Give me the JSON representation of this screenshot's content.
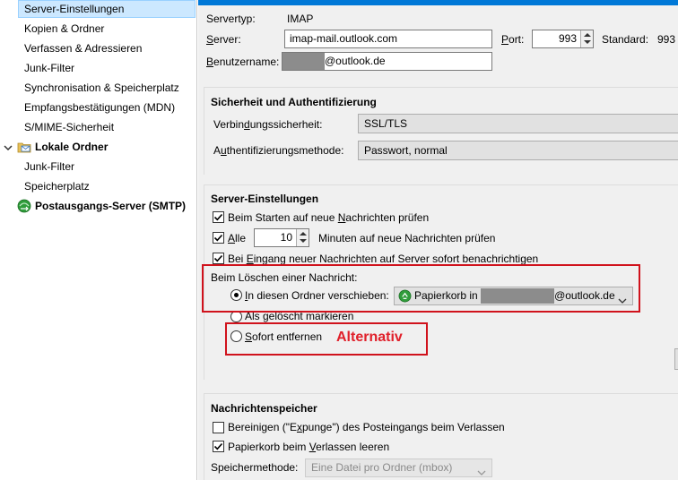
{
  "sidebar": {
    "items": [
      {
        "label": "Server-Einstellungen"
      },
      {
        "label": "Kopien & Ordner"
      },
      {
        "label": "Verfassen & Adressieren"
      },
      {
        "label": "Junk-Filter"
      },
      {
        "label": "Synchronisation & Speicherplatz"
      },
      {
        "label": "Empfangsbestätigungen (MDN)"
      },
      {
        "label": "S/MIME-Sicherheit"
      },
      {
        "label": "Lokale Ordner"
      },
      {
        "label": "Junk-Filter"
      },
      {
        "label": "Speicherplatz"
      },
      {
        "label": "Postausgangs-Server (SMTP)"
      }
    ]
  },
  "server": {
    "type_label": "Servertyp:",
    "type_value": "IMAP",
    "server_label_pre": "",
    "server_label_u": "S",
    "server_label_post": "erver:",
    "server_value": "imap-mail.outlook.com",
    "port_label_u": "P",
    "port_label_post": "ort:",
    "port_value": "993",
    "standard_label": "Standard:",
    "standard_value": "993",
    "user_label_u": "B",
    "user_label_post": "enutzername:",
    "user_suffix": "@outlook.de"
  },
  "security": {
    "title": "Sicherheit und Authentifizierung",
    "conn_label_pre": "Verbin",
    "conn_label_u": "d",
    "conn_label_post": "ungssicherheit:",
    "conn_value": "SSL/TLS",
    "auth_label_pre": "A",
    "auth_label_u": "u",
    "auth_label_post": "thentifizierungsmethode:",
    "auth_value": "Passwort, normal"
  },
  "server_settings": {
    "title": "Server-Einstellungen",
    "check_start_pre": "Beim Starten auf neue ",
    "check_start_u": "N",
    "check_start_post": "achrichten prüfen",
    "check_every_u": "A",
    "check_every_post": "lle",
    "every_value": "10",
    "every_suffix": "Minuten auf neue Nachrichten prüfen",
    "notify_pre": "Bei ",
    "notify_u": "E",
    "notify_post": "ingang neuer Nachrichten auf Server sofort benachrichtigen",
    "delete_title": "Beim Löschen einer Nachricht:",
    "move_u": "I",
    "move_post": "n diesen Ordner verschieben:",
    "move_folder_pre": "Papierkorb in",
    "move_folder_post": "@outlook.de",
    "mark_deleted": "Als gelöscht markieren",
    "remove_u": "S",
    "remove_post": "ofort entfernen",
    "annotation": "Alternativ"
  },
  "storage": {
    "title": "Nachrichtenspeicher",
    "expunge_pre": "Bereinigen (\"E",
    "expunge_u": "x",
    "expunge_post": "punge\") des Posteingangs beim Verlassen",
    "trash_pre": "Papierkorb beim ",
    "trash_u": "V",
    "trash_post": "erlassen leeren",
    "method_label": "Speichermethode:",
    "method_value": "Eine Datei pro Ordner (mbox)"
  },
  "colors": {
    "accent": "#0078d7",
    "selection": "#cce8ff",
    "highlight_box": "#d0121c",
    "annotation_text": "#e0202a"
  }
}
